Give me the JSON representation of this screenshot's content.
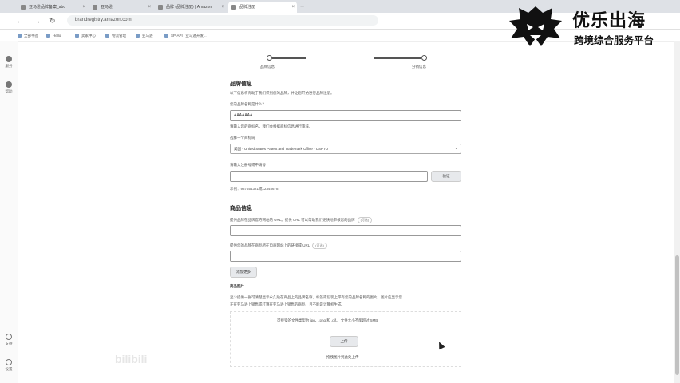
{
  "browser": {
    "tabs": [
      {
        "label": "亚马逊品牌备案_abc"
      },
      {
        "label": "亚马逊"
      },
      {
        "label": "品牌 (品牌注册) | Amazon"
      },
      {
        "label": "品牌注册"
      }
    ],
    "new_tab": "+",
    "url": "brandregistry.amazon.com"
  },
  "bookmarks": [
    "全部书签",
    "Hello",
    "卖家中心",
    "物流管理",
    "亚马逊",
    "SP-API | 亚马逊开发..."
  ],
  "rail": [
    {
      "label": "服务",
      "icon": "home-icon"
    },
    {
      "label": "帮助",
      "icon": "compass-icon"
    },
    {
      "label": "支持",
      "icon": "help-icon"
    },
    {
      "label": "设置",
      "icon": "gear-icon"
    }
  ],
  "steps": {
    "left_label": "品牌信息",
    "right_label": "分销信息"
  },
  "brand_info": {
    "heading": "品牌信息",
    "intro": "以下信息将有助于我们识别您的品牌，并让您开始进行品牌注册。",
    "name_label": "您的品牌名称是什么？",
    "name_value": "AAAAAAA",
    "name_hint": "请输入您的商标名，我们会根据商标信息进行审核。",
    "office_label": "选择一个商标局",
    "office_value": "美国 - United States Patent and Trademark Office - USPTO",
    "reg_label": "请输入注册号或申请号",
    "reg_button": "验证",
    "reg_example": "示例：987654321或12345678"
  },
  "product_info": {
    "heading": "商品信息",
    "website_label": "提供品牌在品牌官方网站的 URL。提供 URL 可以帮助我们更快地审核您的品牌",
    "website_optional": "(可选)",
    "marketplace_label": "提供您的品牌在商品所在电商网站上的链接或 URL",
    "marketplace_optional": "(可选)",
    "add_more_button": "添加更多",
    "images_heading": "商品图片",
    "images_desc_1": "至少提供一张可清楚显示永久贴在商品上的品牌名称，标签或包装上带有您的品牌名称的图片。图片应显示您",
    "images_desc_2": "正在亚马逊上销售或打算在亚马逊上销售的商品，且不能是计算机生成。",
    "upload_hint": "可接受的文件类型为 jpg、.png 和 .gif。     文件大小不能超过 5MB",
    "upload_button": "上传",
    "upload_link": "拖拽图片到此处上传"
  },
  "logo": {
    "title": "优乐出海",
    "subtitle": "跨境综合服务平台"
  },
  "watermark": "bilibili"
}
